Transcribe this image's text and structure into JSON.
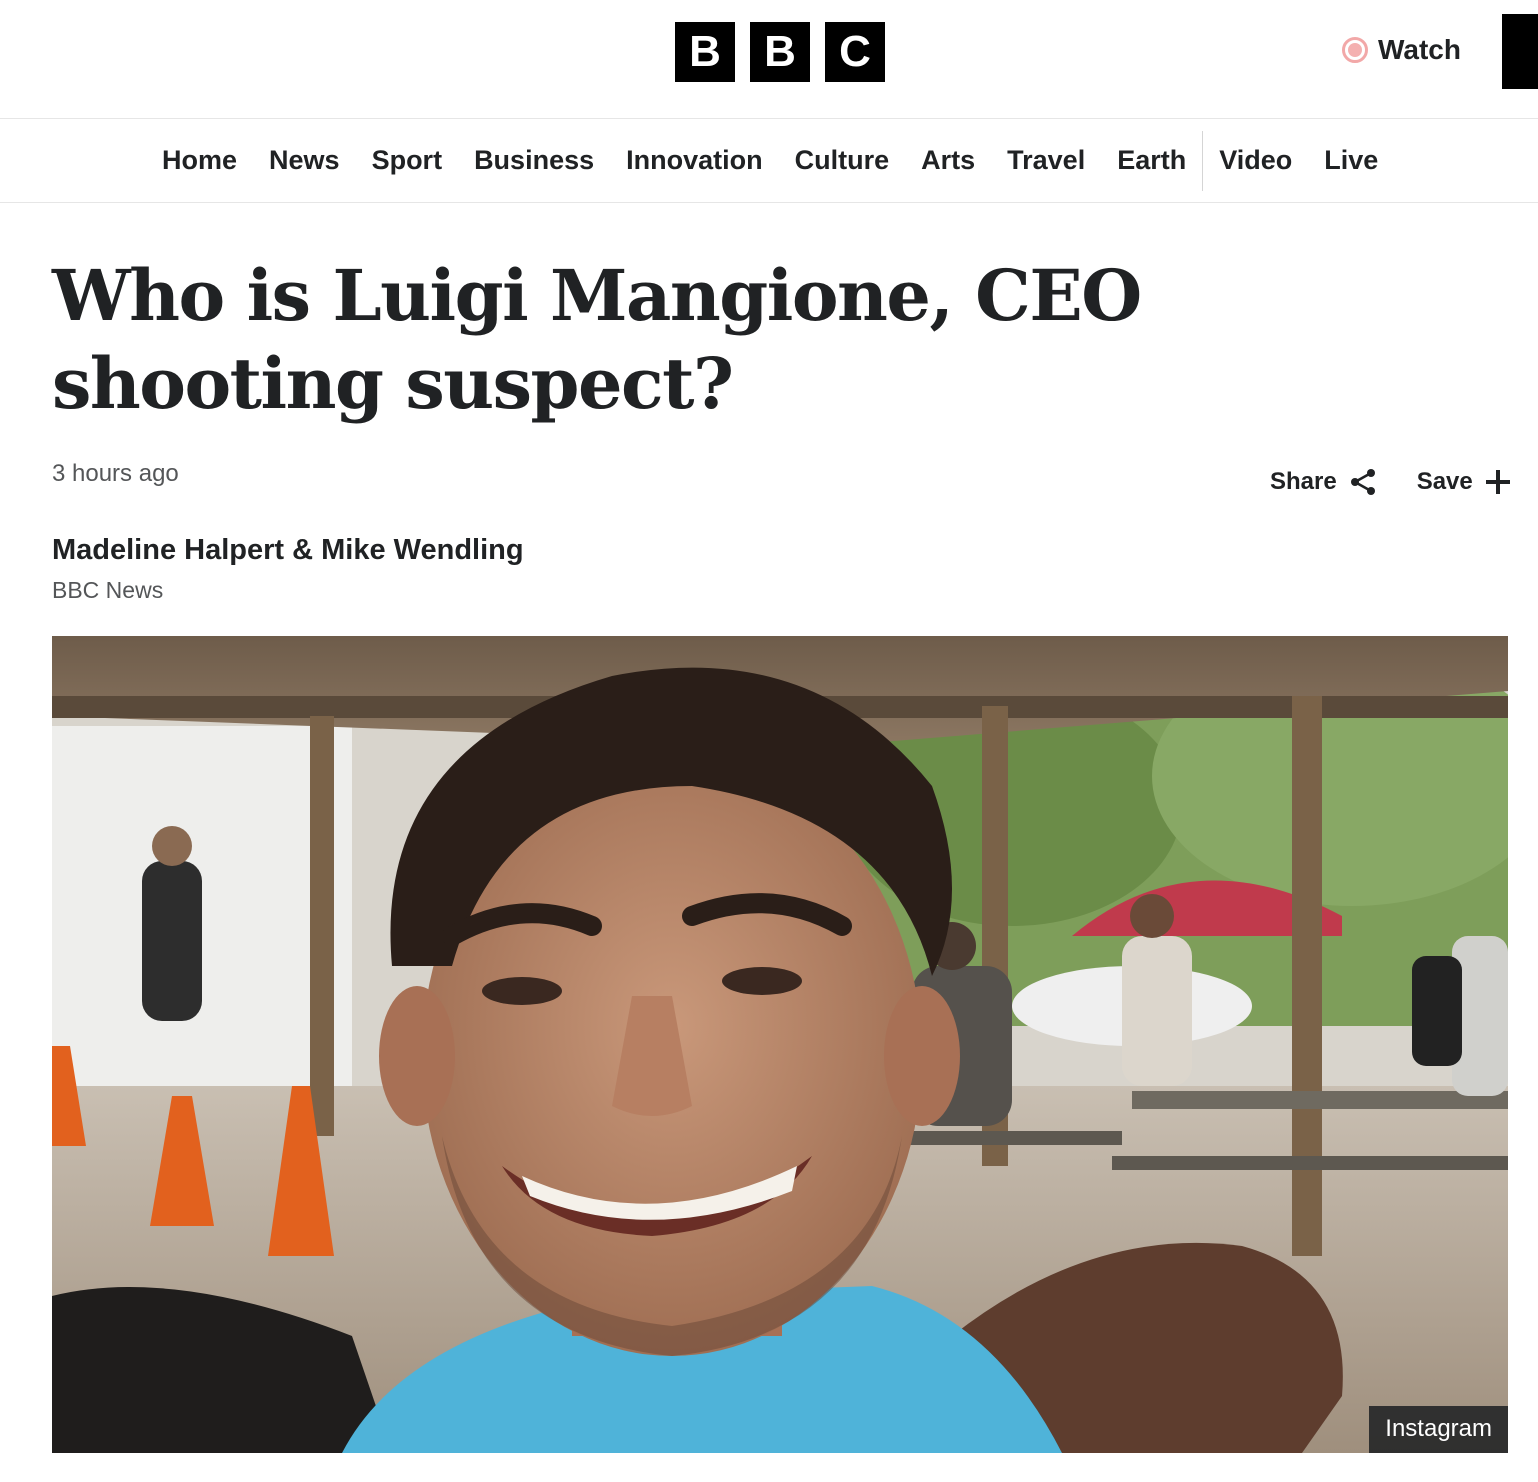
{
  "header": {
    "logo_letters": [
      "B",
      "B",
      "C"
    ],
    "watch_label": "Watch"
  },
  "nav": {
    "items": [
      "Home",
      "News",
      "Sport",
      "Business",
      "Innovation",
      "Culture",
      "Arts",
      "Travel",
      "Earth"
    ],
    "items_after_divider": [
      "Video",
      "Live"
    ]
  },
  "article": {
    "headline": "Who is Luigi Mangione, CEO shooting suspect?",
    "timestamp": "3 hours ago",
    "share_label": "Share",
    "save_label": "Save",
    "authors": "Madeline Halpert & Mike Wendling",
    "outlet": "BBC News",
    "image_credit": "Instagram"
  },
  "icons": {
    "watch": "live-dot-icon",
    "share": "share-icon",
    "save": "plus-icon"
  },
  "colors": {
    "brand_black": "#000000",
    "text": "#202224",
    "meta_text": "#545658",
    "live_dot": "#f2a8a8"
  }
}
